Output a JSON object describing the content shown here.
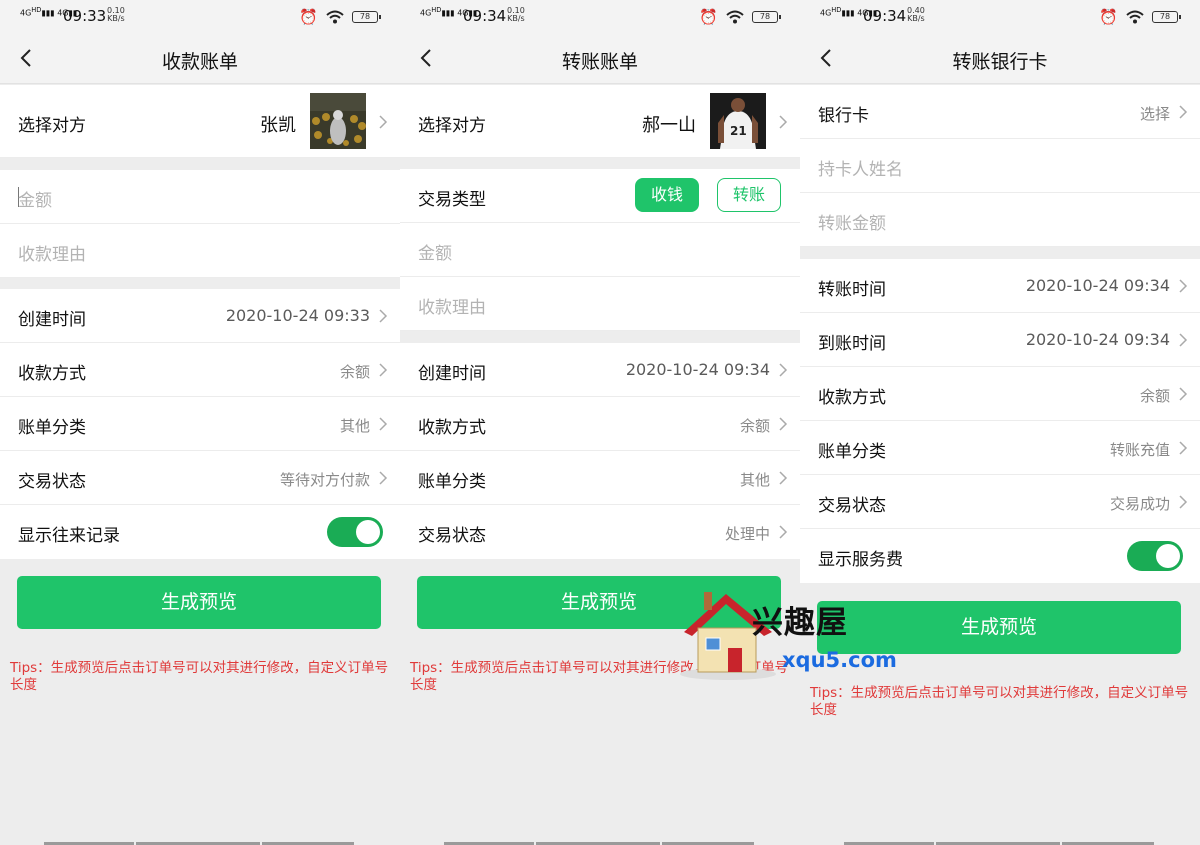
{
  "status_bars": [
    {
      "network": "4G",
      "time": "09:33",
      "speed_top": "0.10",
      "speed_unit": "KB/s",
      "battery": "78"
    },
    {
      "network": "4G",
      "time": "09:34",
      "speed_top": "0.10",
      "speed_unit": "KB/s",
      "battery": "78"
    },
    {
      "network": "4G",
      "time": "09:34",
      "speed_top": "0.40",
      "speed_unit": "KB/s",
      "battery": "78"
    }
  ],
  "screen1": {
    "title": "收款账单",
    "counterparty_label": "选择对方",
    "counterparty_name": "张凯",
    "amount_placeholder": "金额",
    "reason_placeholder": "收款理由",
    "rows": [
      {
        "label": "创建时间",
        "value": "2020-10-24 09:33"
      },
      {
        "label": "收款方式",
        "value": "余额"
      },
      {
        "label": "账单分类",
        "value": "其他"
      },
      {
        "label": "交易状态",
        "value": "等待对方付款"
      }
    ],
    "toggle_label": "显示往来记录",
    "toggle_on": true,
    "button": "生成预览",
    "tips": "Tips：生成预览后点击订单号可以对其进行修改，自定义订单号长度"
  },
  "screen2": {
    "title": "转账账单",
    "counterparty_label": "选择对方",
    "counterparty_name": "郝一山",
    "type_label": "交易类型",
    "type_options": [
      "收钱",
      "转账"
    ],
    "amount_placeholder": "金额",
    "reason_placeholder": "收款理由",
    "rows": [
      {
        "label": "创建时间",
        "value": "2020-10-24 09:34"
      },
      {
        "label": "收款方式",
        "value": "余额"
      },
      {
        "label": "账单分类",
        "value": "其他"
      },
      {
        "label": "交易状态",
        "value": "处理中"
      }
    ],
    "button": "生成预览",
    "tips": "Tips：生成预览后点击订单号可以对其进行修改，自定义订单号长度"
  },
  "screen3": {
    "title": "转账银行卡",
    "bank_label": "银行卡",
    "bank_value": "选择",
    "holder_placeholder": "持卡人姓名",
    "amount_placeholder": "转账金额",
    "rows": [
      {
        "label": "转账时间",
        "value": "2020-10-24 09:34"
      },
      {
        "label": "到账时间",
        "value": "2020-10-24 09:34"
      },
      {
        "label": "收款方式",
        "value": "余额"
      },
      {
        "label": "账单分类",
        "value": "转账充值"
      },
      {
        "label": "交易状态",
        "value": "交易成功"
      }
    ],
    "toggle_label": "显示服务费",
    "toggle_on": true,
    "button": "生成预览",
    "tips": "Tips：生成预览后点击订单号可以对其进行修改，自定义订单号长度"
  },
  "watermark": {
    "cn": "兴趣屋",
    "en": "xqu5.com"
  },
  "colors": {
    "accent": "#1fc46a",
    "toggle": "#1aac55",
    "tips": "#e03a3a"
  }
}
